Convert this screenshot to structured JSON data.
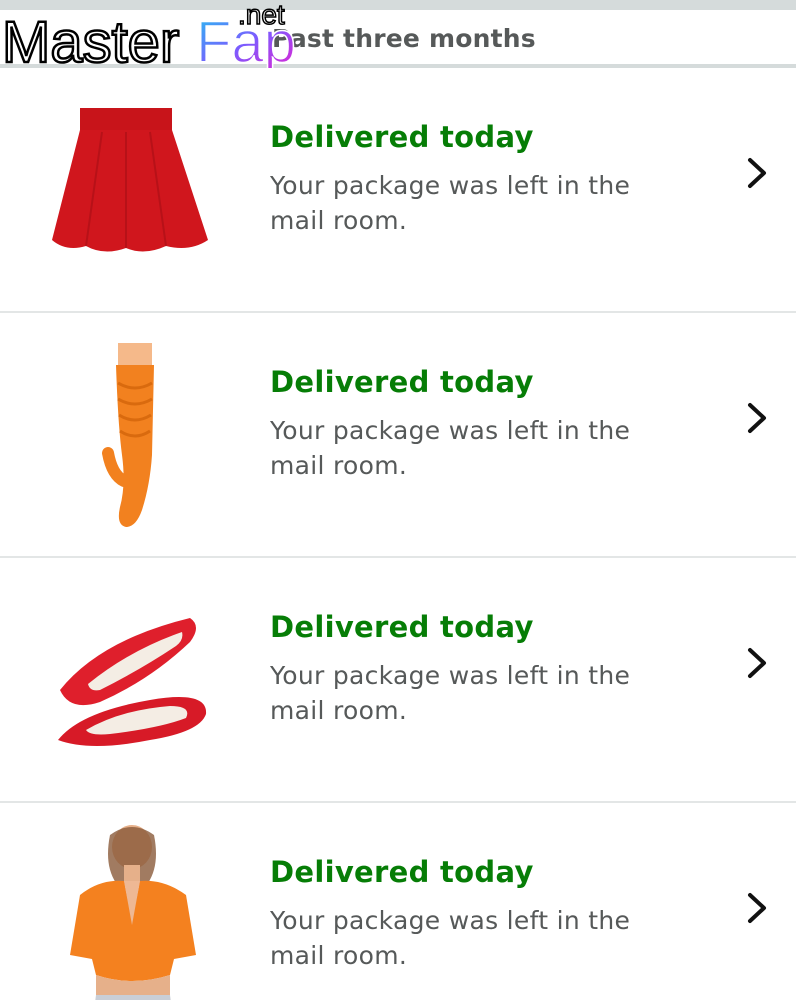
{
  "section": {
    "title": "Past three months"
  },
  "watermark": {
    "text_main": "Master",
    "text_accent": "Fap",
    "text_suffix": ".net"
  },
  "orders": [
    {
      "status": "Delivered today",
      "detail": "Your package was left in the mail room.",
      "product_icon": "red-skirt-image"
    },
    {
      "status": "Delivered today",
      "detail": "Your package was left in the mail room.",
      "product_icon": "orange-sock-image"
    },
    {
      "status": "Delivered today",
      "detail": "Your package was left in the mail room.",
      "product_icon": "red-flats-image"
    },
    {
      "status": "Delivered today",
      "detail": "Your package was left in the mail room.",
      "product_icon": "orange-crop-top-image"
    }
  ],
  "colors": {
    "status_green": "#067d06",
    "secondary_text": "#565959",
    "divider": "#e3e6e6"
  }
}
